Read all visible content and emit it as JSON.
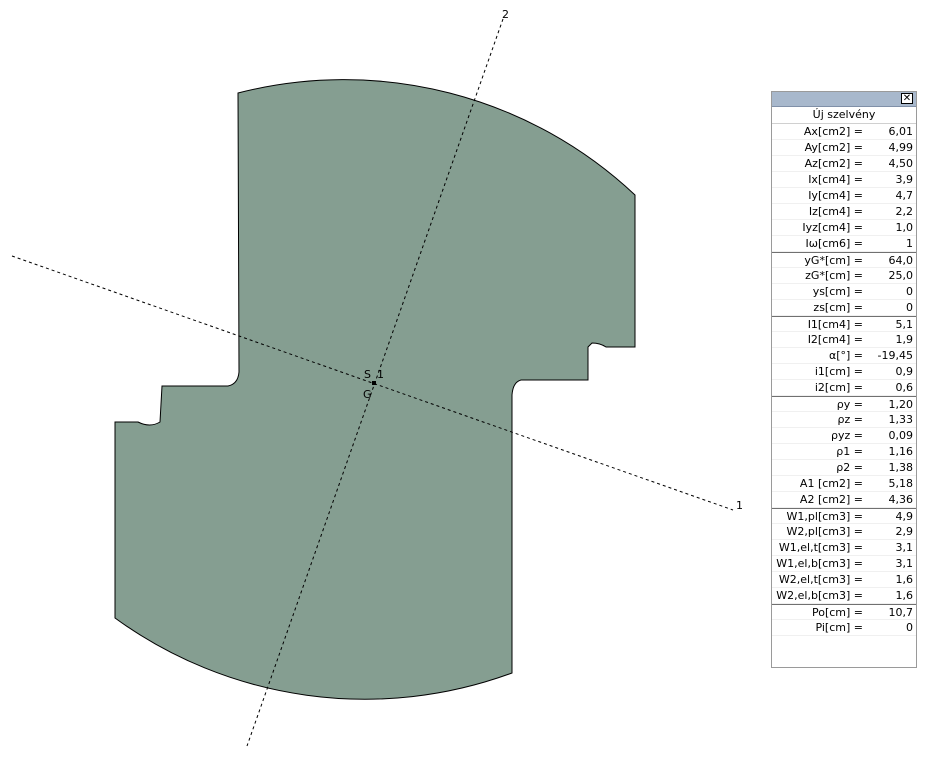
{
  "drawing": {
    "axis_1_label": "1",
    "axis_2_label": "2",
    "shear_center_label": "S",
    "centroid_label": "G",
    "principal_marker_label": "1",
    "section_fill": "#859e91",
    "section_stroke": "#000000"
  },
  "panel": {
    "title": "Új szelvény",
    "close_icon": "close-icon",
    "rows": [
      {
        "label": "Ax[cm2] =",
        "value": "6,01"
      },
      {
        "label": "Ay[cm2] =",
        "value": "4,99"
      },
      {
        "label": "Az[cm2] =",
        "value": "4,50"
      },
      {
        "label": "Ix[cm4] =",
        "value": "3,9"
      },
      {
        "label": "Iy[cm4] =",
        "value": "4,7"
      },
      {
        "label": "Iz[cm4] =",
        "value": "2,2"
      },
      {
        "label": "Iyz[cm4] =",
        "value": "1,0"
      },
      {
        "label": "Iω[cm6] =",
        "value": "1"
      },
      {
        "label": "yG*[cm] =",
        "value": "64,0"
      },
      {
        "label": "zG*[cm] =",
        "value": "25,0"
      },
      {
        "label": "ys[cm] =",
        "value": "0"
      },
      {
        "label": "zs[cm] =",
        "value": "0"
      },
      {
        "label": "I1[cm4] =",
        "value": "5,1"
      },
      {
        "label": "I2[cm4] =",
        "value": "1,9"
      },
      {
        "label": "α[°] =",
        "value": "-19,45"
      },
      {
        "label": "i1[cm] =",
        "value": "0,9"
      },
      {
        "label": "i2[cm] =",
        "value": "0,6"
      },
      {
        "label": "ρy =",
        "value": "1,20"
      },
      {
        "label": "ρz =",
        "value": "1,33"
      },
      {
        "label": "ρyz =",
        "value": "0,09"
      },
      {
        "label": "ρ1 =",
        "value": "1,16"
      },
      {
        "label": "ρ2 =",
        "value": "1,38"
      },
      {
        "label": "A1 [cm2] =",
        "value": "5,18"
      },
      {
        "label": "A2 [cm2] =",
        "value": "4,36"
      },
      {
        "label": "W1,pl[cm3] =",
        "value": "4,9"
      },
      {
        "label": "W2,pl[cm3] =",
        "value": "2,9"
      },
      {
        "label": "W1,el,t[cm3] =",
        "value": "3,1"
      },
      {
        "label": "W1,el,b[cm3] =",
        "value": "3,1"
      },
      {
        "label": "W2,el,t[cm3] =",
        "value": "1,6"
      },
      {
        "label": "W2,el,b[cm3] =",
        "value": "1,6"
      },
      {
        "label": "Po[cm] =",
        "value": "10,7"
      },
      {
        "label": "Pi[cm] =",
        "value": "0"
      }
    ]
  }
}
